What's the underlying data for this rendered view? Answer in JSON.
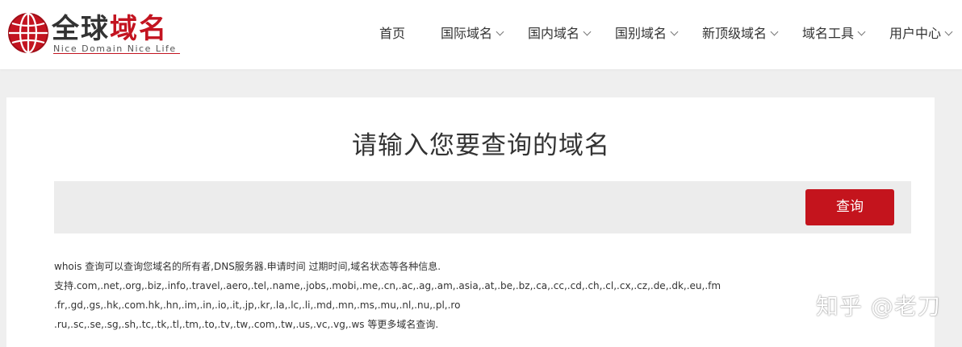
{
  "logo": {
    "title_part1": "全球",
    "title_part2": "域名",
    "subtitle": "Nice Domain Nice Life"
  },
  "nav": {
    "items": [
      {
        "label": "首页",
        "has_dropdown": false
      },
      {
        "label": "国际域名",
        "has_dropdown": true
      },
      {
        "label": "国内域名",
        "has_dropdown": true
      },
      {
        "label": "国别域名",
        "has_dropdown": true
      },
      {
        "label": "新顶级域名",
        "has_dropdown": true
      },
      {
        "label": "域名工具",
        "has_dropdown": true
      },
      {
        "label": "用户中心",
        "has_dropdown": true
      }
    ]
  },
  "main": {
    "heading": "请输入您要查询的域名",
    "search": {
      "value": "",
      "placeholder": "",
      "button_label": "查询"
    },
    "info_lines": [
      "whois 查询可以查询您域名的所有者,DNS服务器.申请时间 过期时间,域名状态等各种信息.",
      "支持.com,.net,.org,.biz,.info,.travel,.aero,.tel,.name,.jobs,.mobi,.me,.cn,.ac,.ag,.am,.asia,.at,.be,.bz,.ca,.cc,.cd,.ch,.cl,.cx,.cz,.de,.dk,.eu,.fm",
      ".fr,.gd,.gs,.hk,.com.hk,.hn,.im,.in,.io,.it,.jp,.kr,.la,.lc,.li,.md,.mn,.ms,.mu,.nl,.nu,.pl,.ro",
      ".ru,.sc,.se,.sg,.sh,.tc,.tk,.tl,.tm,.to,.tv,.tw,.com,.tw,.us,.vc,.vg,.ws 等更多域名查询."
    ]
  },
  "watermark": "知乎 @老刀",
  "colors": {
    "brand_red": "#c4141d",
    "page_bg": "#efefef",
    "search_bg": "#ececec"
  }
}
